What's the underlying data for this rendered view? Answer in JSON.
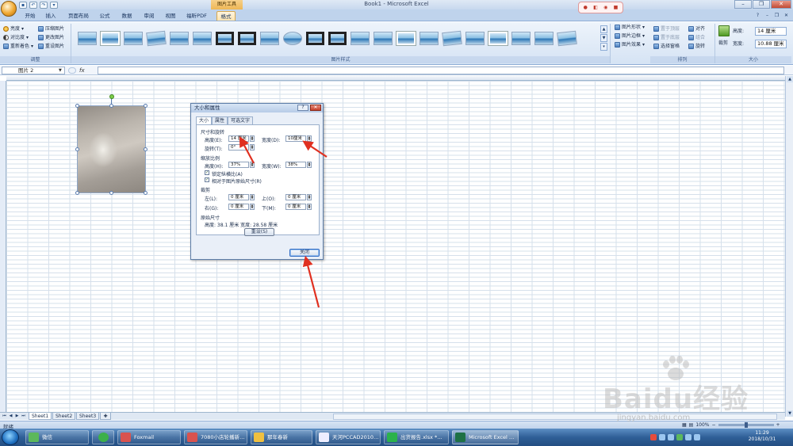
{
  "window": {
    "title": "Book1 - Microsoft Excel",
    "context_tab_label": "图片工具"
  },
  "ribbon_tabs": [
    {
      "label": "开始"
    },
    {
      "label": "插入"
    },
    {
      "label": "页面布局"
    },
    {
      "label": "公式"
    },
    {
      "label": "数据"
    },
    {
      "label": "审阅"
    },
    {
      "label": "视图"
    },
    {
      "label": "福昕PDF"
    },
    {
      "label": "格式"
    }
  ],
  "ribbon": {
    "adjust": {
      "label": "调整",
      "items": [
        "亮度",
        "对比度",
        "重新着色",
        "压缩图片",
        "更改图片",
        "重设图片"
      ]
    },
    "styles": {
      "label": "图片样式"
    },
    "picture_effects": [
      "图片形状",
      "图片边框",
      "图片效果"
    ],
    "arrange": {
      "label": "排列",
      "items": [
        "置于顶层",
        "置于底层",
        "选择窗格",
        "对齐",
        "组合",
        "旋转"
      ]
    },
    "size": {
      "label": "大小",
      "crop_label": "裁剪",
      "height_label": "高度:",
      "height_value": "14 厘米",
      "width_label": "宽度:",
      "width_value": "10.88 厘米"
    }
  },
  "formula_bar": {
    "name_box": "图片 2",
    "fx": "fx"
  },
  "dialog": {
    "title": "大小和属性",
    "tabs": [
      "大小",
      "属性",
      "可选文字"
    ],
    "size_rotate": {
      "title": "尺寸和旋转",
      "height_label": "高度(E):",
      "height_value": "14 厘米",
      "width_label": "宽度(D):",
      "width_value": "10厘米",
      "rotation_label": "旋转(T):",
      "rotation_value": "0°"
    },
    "scale": {
      "title": "缩放比例",
      "height_label": "高度(H):",
      "height_value": "37%",
      "width_label": "宽度(W):",
      "width_value": "38%",
      "lock_aspect": "锁定纵横比(A)",
      "relative_original": "相对于图片原始尺寸(R)"
    },
    "crop": {
      "title": "裁剪",
      "left_label": "左(L):",
      "left_value": "0 厘米",
      "top_label": "上(O):",
      "top_value": "0 厘米",
      "right_label": "右(G):",
      "right_value": "0 厘米",
      "bottom_label": "下(M):",
      "bottom_value": "0 厘米"
    },
    "original": {
      "title": "原始尺寸",
      "text": "高度:  38.1 厘米   宽度:  28.58 厘米",
      "reset_label": "重设(S)"
    },
    "close_label": "关闭"
  },
  "sheets": [
    "Sheet1",
    "Sheet2",
    "Sheet3"
  ],
  "status": {
    "text": "就绪",
    "zoom": "100%"
  },
  "taskbar": {
    "items": [
      "微信",
      "",
      "Foxmail",
      "7080小店轮播新…",
      "那年春新",
      "天河PCCAD2010…",
      "出货报告.xlsx *…",
      "Microsoft Excel …"
    ],
    "time": "11:29",
    "date": "2018/10/31"
  },
  "watermark": {
    "brand": "Baidu经验",
    "url": "jingyan.baidu.com"
  },
  "colors": {
    "ribbon": "#d5e3f4",
    "dialog": "#e9eff8",
    "taskbar": "#2f5f97",
    "annotation": "#e03020"
  }
}
